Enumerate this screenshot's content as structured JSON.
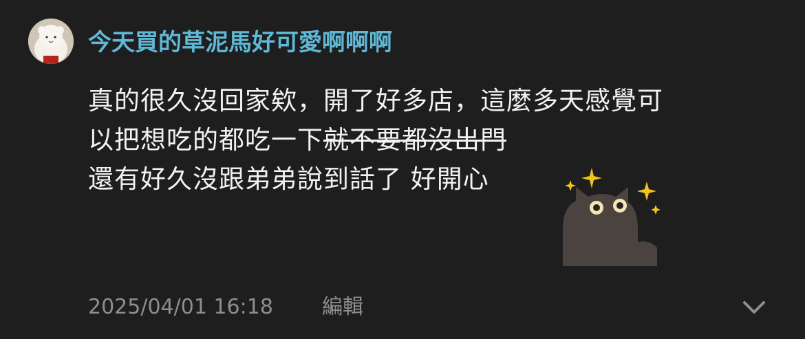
{
  "post": {
    "author": "今天買的草泥馬好可愛啊啊啊",
    "body": {
      "line1": "真的很久沒回家欸，開了好多店，這麼多天感覺可",
      "line2_plain": "以把想吃的都吃一下",
      "line2_strike": "就不要都沒出門",
      "line3": "還有好久沒跟弟弟說到話了 好開心"
    },
    "timestamp": "2025/04/01 16:18",
    "edit_label": "編輯"
  },
  "icons": {
    "avatar": "alpaca-plush-avatar",
    "sticker": "sparkle-cat-sticker",
    "expand": "chevron-down-icon"
  },
  "colors": {
    "background": "#1e1e1e",
    "author": "#5fb8d6",
    "text": "#f2f2f2",
    "meta": "#8e8e8e",
    "sparkle": "#f0c419"
  }
}
